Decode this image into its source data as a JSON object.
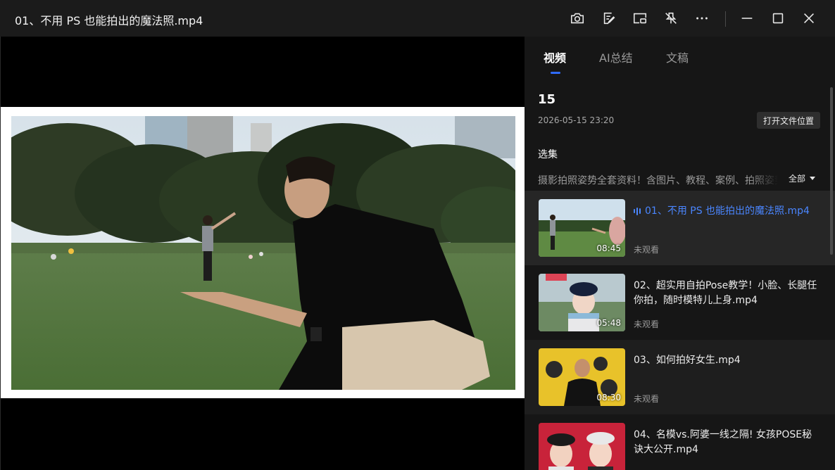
{
  "window": {
    "title": "01、不用 PS 也能拍出的魔法照.mp4",
    "buttons": [
      "camera-icon",
      "edit-note-icon",
      "picture-in-picture-icon",
      "no-pin-icon",
      "more-icon",
      "minimize-icon",
      "maximize-icon",
      "close-icon"
    ]
  },
  "tabs": [
    {
      "label": "视频",
      "active": true
    },
    {
      "label": "AI总结",
      "active": false
    },
    {
      "label": "文稿",
      "active": false
    }
  ],
  "info": {
    "title": "15",
    "date": "2026-05-15 23:20",
    "open_location": "打开文件位置"
  },
  "series": {
    "label": "选集",
    "title": "摄影拍照姿势全套资料！含图片、教程、案例、拍照姿势",
    "filter": "全部"
  },
  "episodes": [
    {
      "title": "01、不用 PS 也能拍出的魔法照.mp4",
      "duration": "08:45",
      "status": "未观看",
      "playing": true
    },
    {
      "title": "02、超实用自拍Pose教学！小脸、长腿任你拍，随时模特儿上身.mp4",
      "duration": "05:48",
      "status": "未观看",
      "playing": false
    },
    {
      "title": "03、如何拍好女生.mp4",
      "duration": "08:30",
      "status": "未观看",
      "playing": false
    },
    {
      "title": "04、名模vs.阿婆一线之隔! 女孩POSE秘诀大公开.mp4",
      "duration": "",
      "status": "",
      "playing": false
    }
  ],
  "colors": {
    "accent": "#2f6bff",
    "playing_text": "#4a86ff",
    "sidebar_bg": "#161616",
    "titlebar_bg": "#1b1b1b"
  }
}
